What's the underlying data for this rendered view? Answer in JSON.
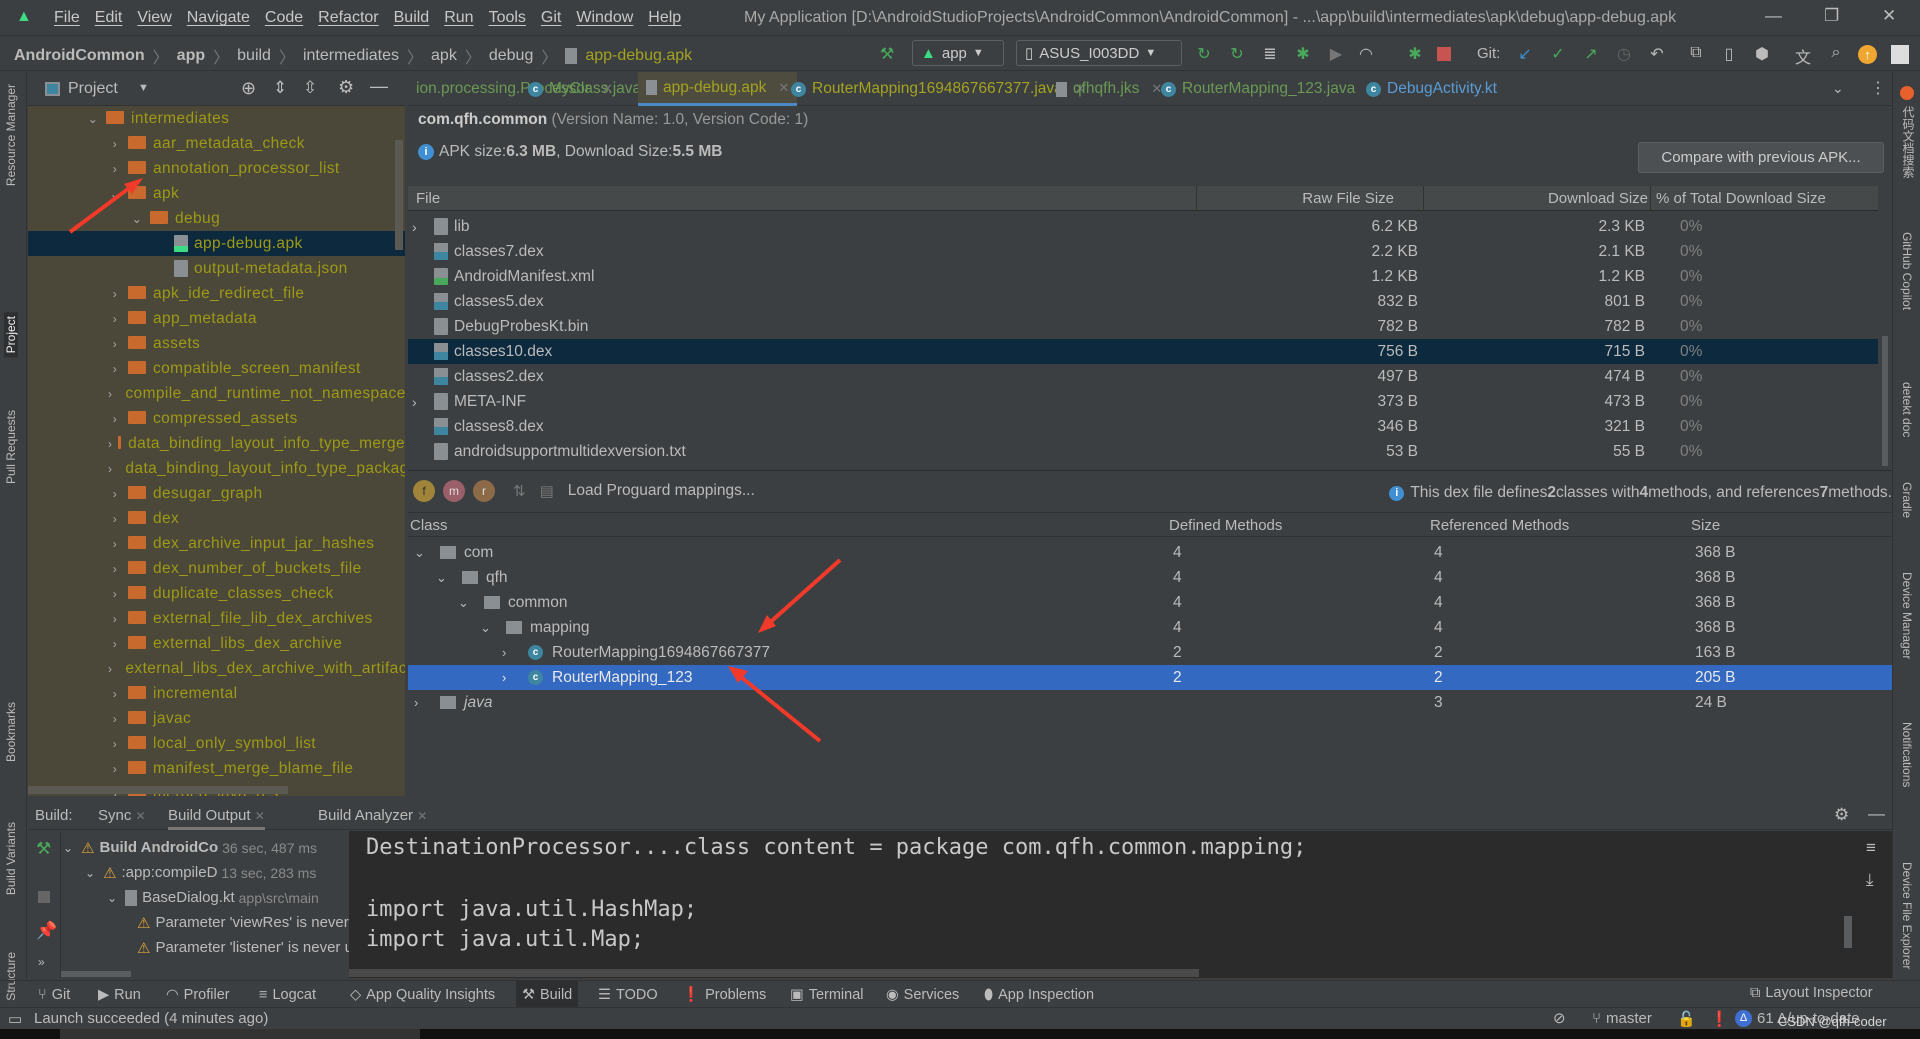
{
  "window": {
    "title": "My Application [D:\\AndroidStudioProjects\\AndroidCommon\\AndroidCommon] - ...\\app\\build\\intermediates\\apk\\debug\\app-debug.apk",
    "menu": [
      "File",
      "Edit",
      "View",
      "Navigate",
      "Code",
      "Refactor",
      "Build",
      "Run",
      "Tools",
      "Git",
      "Window",
      "Help"
    ]
  },
  "breadcrumb": [
    "AndroidCommon",
    "app",
    "build",
    "intermediates",
    "apk",
    "debug",
    "app-debug.apk"
  ],
  "toolbar": {
    "run_config": "app",
    "device": "ASUS_I003DD",
    "git_label": "Git:"
  },
  "left_stripe": [
    "Resource Manager",
    "Project",
    "Pull Requests",
    "Bookmarks",
    "Build Variants",
    "Structure"
  ],
  "right_stripe": [
    "代码文档搜索",
    "GitHub Copilot",
    "detekt doc",
    "Gradle",
    "Device Manager",
    "Notifications",
    "Device File Explorer"
  ],
  "project": {
    "title": "Project",
    "tree": [
      {
        "label": "intermediates",
        "type": "folder",
        "depth": 0,
        "expanded": true
      },
      {
        "label": "aar_metadata_check",
        "type": "folder",
        "depth": 1
      },
      {
        "label": "annotation_processor_list",
        "type": "folder",
        "depth": 1
      },
      {
        "label": "apk",
        "type": "folder",
        "depth": 1,
        "expanded": true
      },
      {
        "label": "debug",
        "type": "folder",
        "depth": 2,
        "expanded": true
      },
      {
        "label": "app-debug.apk",
        "type": "apk",
        "depth": 3,
        "selected": true
      },
      {
        "label": "output-metadata.json",
        "type": "json",
        "depth": 3
      },
      {
        "label": "apk_ide_redirect_file",
        "type": "folder",
        "depth": 1
      },
      {
        "label": "app_metadata",
        "type": "folder",
        "depth": 1
      },
      {
        "label": "assets",
        "type": "folder",
        "depth": 1
      },
      {
        "label": "compatible_screen_manifest",
        "type": "folder",
        "depth": 1
      },
      {
        "label": "compile_and_runtime_not_namespaced_r_class_jar",
        "type": "folder",
        "depth": 1
      },
      {
        "label": "compressed_assets",
        "type": "folder",
        "depth": 1
      },
      {
        "label": "data_binding_layout_info_type_merge",
        "type": "folder",
        "depth": 1
      },
      {
        "label": "data_binding_layout_info_type_package",
        "type": "folder",
        "depth": 1
      },
      {
        "label": "desugar_graph",
        "type": "folder",
        "depth": 1
      },
      {
        "label": "dex",
        "type": "folder",
        "depth": 1
      },
      {
        "label": "dex_archive_input_jar_hashes",
        "type": "folder",
        "depth": 1
      },
      {
        "label": "dex_number_of_buckets_file",
        "type": "folder",
        "depth": 1
      },
      {
        "label": "duplicate_classes_check",
        "type": "folder",
        "depth": 1
      },
      {
        "label": "external_file_lib_dex_archives",
        "type": "folder",
        "depth": 1
      },
      {
        "label": "external_libs_dex_archive",
        "type": "folder",
        "depth": 1
      },
      {
        "label": "external_libs_dex_archive_with_artifact_transforms",
        "type": "folder",
        "depth": 1
      },
      {
        "label": "incremental",
        "type": "folder",
        "depth": 1
      },
      {
        "label": "javac",
        "type": "folder",
        "depth": 1
      },
      {
        "label": "local_only_symbol_list",
        "type": "folder",
        "depth": 1
      },
      {
        "label": "manifest_merge_blame_file",
        "type": "folder",
        "depth": 1
      },
      {
        "label": "merged_java_res",
        "type": "folder",
        "depth": 1
      }
    ]
  },
  "tabs": [
    {
      "label": "ion.processing.Processor",
      "color": "#6a9955",
      "icon": "none"
    },
    {
      "label": "MyClass.java",
      "color": "#6a9955",
      "icon": "class"
    },
    {
      "label": "app-debug.apk",
      "color": "#a3a320",
      "icon": "apk",
      "active": true
    },
    {
      "label": "RouterMapping1694867667377.java",
      "color": "#a3a320",
      "icon": "class"
    },
    {
      "label": "qfhqfh.jks",
      "color": "#6a9955",
      "icon": "file"
    },
    {
      "label": "RouterMapping_123.java",
      "color": "#6a9955",
      "icon": "class"
    },
    {
      "label": "DebugActivity.kt",
      "color": "#5a9bd5",
      "icon": "kotlin-class"
    }
  ],
  "apk": {
    "package": "com.qfh.common",
    "version": "(Version Name: 1.0, Version Code: 1)",
    "size_prefix": "APK size: ",
    "apk_size": "6.3 MB",
    "size_mid": ", Download Size: ",
    "download_size": "5.5 MB",
    "compare_button": "Compare with previous APK...",
    "columns": [
      "File",
      "Raw File Size",
      "Download Size",
      "% of Total Download Size"
    ],
    "files": [
      {
        "name": "lib",
        "type": "folder",
        "raw": "6.2 KB",
        "download": "2.3 KB",
        "pct": "0%"
      },
      {
        "name": "classes7.dex",
        "type": "dex",
        "raw": "2.2 KB",
        "download": "2.1 KB",
        "pct": "0%"
      },
      {
        "name": "AndroidManifest.xml",
        "type": "manifest",
        "raw": "1.2 KB",
        "download": "1.2 KB",
        "pct": "0%"
      },
      {
        "name": "classes5.dex",
        "type": "dex",
        "raw": "832 B",
        "download": "801 B",
        "pct": "0%"
      },
      {
        "name": "DebugProbesKt.bin",
        "type": "unknown",
        "raw": "782 B",
        "download": "782 B",
        "pct": "0%"
      },
      {
        "name": "classes10.dex",
        "type": "dex",
        "raw": "756 B",
        "download": "715 B",
        "pct": "0%",
        "selected": true
      },
      {
        "name": "classes2.dex",
        "type": "dex",
        "raw": "497 B",
        "download": "474 B",
        "pct": "0%"
      },
      {
        "name": "META-INF",
        "type": "folder",
        "raw": "373 B",
        "download": "473 B",
        "pct": "0%"
      },
      {
        "name": "classes8.dex",
        "type": "dex",
        "raw": "346 B",
        "download": "321 B",
        "pct": "0%"
      },
      {
        "name": "androidsupportmultidexversion.txt",
        "type": "text",
        "raw": "53 B",
        "download": "55 B",
        "pct": "0%"
      }
    ],
    "proguard_label": "Load Proguard mappings...",
    "dex_info": {
      "p1": "This dex file defines ",
      "classes": "2",
      "p2": " classes with ",
      "methods": "4",
      "p3": " methods, and references ",
      "refs": "7",
      "p4": " methods."
    },
    "class_columns": [
      "Class",
      "Defined Methods",
      "Referenced Methods",
      "Size"
    ],
    "classes": [
      {
        "name": "com",
        "depth": 0,
        "type": "package",
        "expanded": true,
        "defined": "4",
        "referenced": "4",
        "size": "368 B"
      },
      {
        "name": "qfh",
        "depth": 1,
        "type": "package",
        "expanded": true,
        "defined": "4",
        "referenced": "4",
        "size": "368 B"
      },
      {
        "name": "common",
        "depth": 2,
        "type": "package",
        "expanded": true,
        "defined": "4",
        "referenced": "4",
        "size": "368 B"
      },
      {
        "name": "mapping",
        "depth": 3,
        "type": "package",
        "expanded": true,
        "defined": "4",
        "referenced": "4",
        "size": "368 B"
      },
      {
        "name": "RouterMapping1694867667377",
        "depth": 4,
        "type": "class",
        "defined": "2",
        "referenced": "2",
        "size": "163 B"
      },
      {
        "name": "RouterMapping_123",
        "depth": 4,
        "type": "class",
        "defined": "2",
        "referenced": "2",
        "size": "205 B",
        "selected": true
      },
      {
        "name": "java",
        "depth": 0,
        "type": "package",
        "italic": true,
        "defined": "",
        "referenced": "3",
        "size": "24 B"
      }
    ]
  },
  "build": {
    "label": "Build:",
    "tabs": [
      "Sync",
      "Build Output",
      "Build Analyzer"
    ],
    "tree": [
      {
        "label": "Build AndroidCo",
        "time": "36 sec, 487 ms",
        "bold": true,
        "warn": true
      },
      {
        "label": ":app:compileD",
        "time": "13 sec, 283 ms",
        "warn": true
      },
      {
        "label": "BaseDialog.kt",
        "time": "app\\src\\main",
        "warn": false
      },
      {
        "label": "Parameter 'viewRes' is never used",
        "time": "",
        "warn": true
      },
      {
        "label": "Parameter 'listener' is never used",
        "time": "",
        "warn": true
      }
    ],
    "console": [
      "DestinationProcessor....class content = package com.qfh.common.mapping;",
      "",
      "import java.util.HashMap;",
      "import java.util.Map;"
    ]
  },
  "bottom_tools": [
    "Git",
    "Run",
    "Profiler",
    "Logcat",
    "App Quality Insights",
    "Build",
    "TODO",
    "Problems",
    "Terminal",
    "Services",
    "App Inspection"
  ],
  "layout_inspector": "Layout Inspector",
  "status": {
    "message": "Launch succeeded (4 minutes ago)",
    "branch": "master",
    "updates": "61 Δ/up-to-date",
    "watermark": "CSDN @qfh-coder"
  },
  "colors": {
    "accent": "#4a88c7",
    "selection": "#0d293e",
    "class_selection": "#3469c2",
    "folder": "#c8692e",
    "scope_text": "#9c9a16"
  }
}
